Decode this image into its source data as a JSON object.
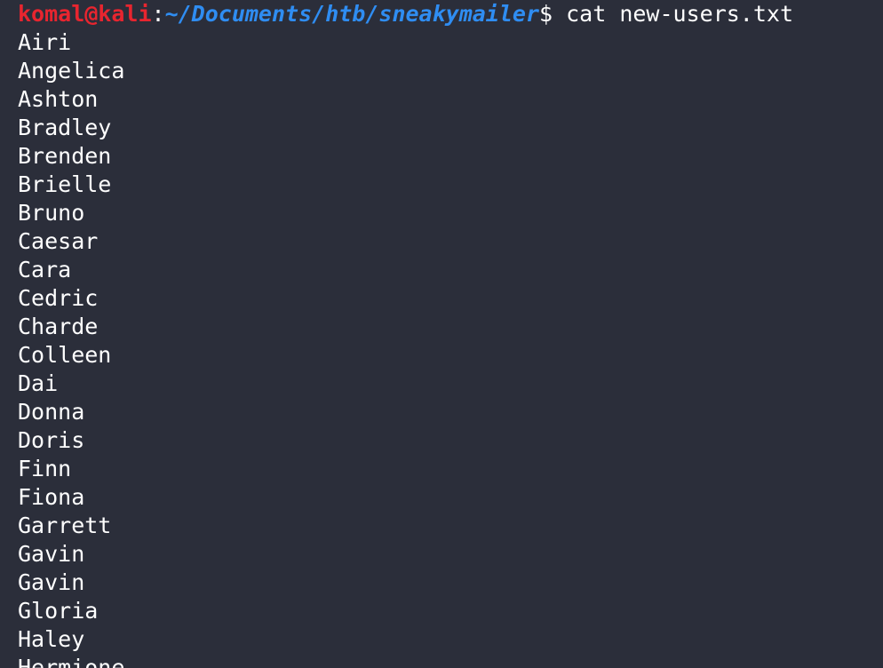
{
  "terminal": {
    "prompt": {
      "user_host": "komal@kali",
      "separator": ":",
      "path": "~/Documents/htb/sneakymailer",
      "symbol": "$"
    },
    "command": " cat new-users.txt",
    "output": [
      "Airi",
      "Angelica",
      "Ashton",
      "Bradley",
      "Brenden",
      "Brielle",
      "Bruno",
      "Caesar",
      "Cara",
      "Cedric",
      "Charde",
      "Colleen",
      "Dai",
      "Donna",
      "Doris",
      "Finn",
      "Fiona",
      "Garrett",
      "Gavin",
      "Gavin",
      "Gloria",
      "Haley",
      "Hermione"
    ],
    "colors": {
      "background": "#2b2e3a",
      "user_host": "#e8252f",
      "path": "#2f8df2",
      "text": "#ffffff"
    }
  }
}
